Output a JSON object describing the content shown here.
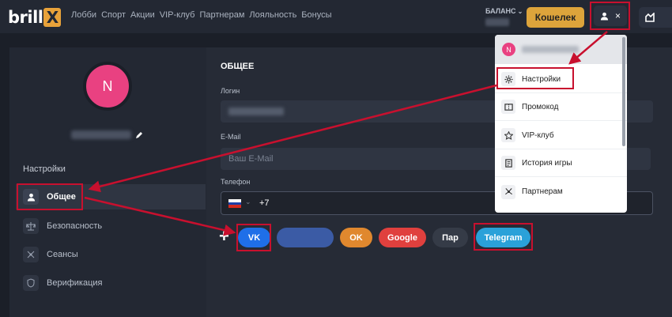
{
  "brand": {
    "text": "brill",
    "mark": "X"
  },
  "nav": [
    "Лобби",
    "Спорт",
    "Акции",
    "VIP-клуб",
    "Партнерам",
    "Лояльность",
    "Бонусы"
  ],
  "balance": {
    "label": "БАЛАНС"
  },
  "wallet_label": "Кошелек",
  "user_menu_close": "×",
  "profile": {
    "avatar_letter": "N"
  },
  "sidebar": {
    "heading": "Настройки",
    "items": [
      {
        "label": "Общее",
        "icon": "user-icon"
      },
      {
        "label": "Безопасность",
        "icon": "scales-icon"
      },
      {
        "label": "Сеансы",
        "icon": "network-icon"
      },
      {
        "label": "Верификация",
        "icon": "shield-icon"
      }
    ]
  },
  "form": {
    "title": "ОБЩЕЕ",
    "login_label": "Логин",
    "email_label": "E-Mail",
    "email_placeholder": "Ваш E-Mail",
    "phone_label": "Телефон",
    "phone_code": "+7"
  },
  "social": {
    "plus": "+",
    "buttons": [
      {
        "label": "VK",
        "color": "#1f6fe8"
      },
      {
        "label": "",
        "color": "#3b5ba5"
      },
      {
        "label": "OK",
        "color": "#e0882e"
      },
      {
        "label": "Google",
        "color": "#e0403e"
      },
      {
        "label": "Пар",
        "color": "#353b47"
      },
      {
        "label": "Telegram",
        "color": "#2aa1d9"
      }
    ]
  },
  "dropdown": {
    "avatar_letter": "N",
    "items": [
      {
        "label": "Настройки",
        "icon": "gear-icon"
      },
      {
        "label": "Промокод",
        "icon": "ticket-icon"
      },
      {
        "label": "VIP-клуб",
        "icon": "star-icon"
      },
      {
        "label": "История игры",
        "icon": "history-icon"
      },
      {
        "label": "Партнерам",
        "icon": "partners-icon"
      }
    ]
  },
  "colors": {
    "annotation": "#c8102e",
    "accent": "#dda43b",
    "avatar": "#e94181"
  }
}
